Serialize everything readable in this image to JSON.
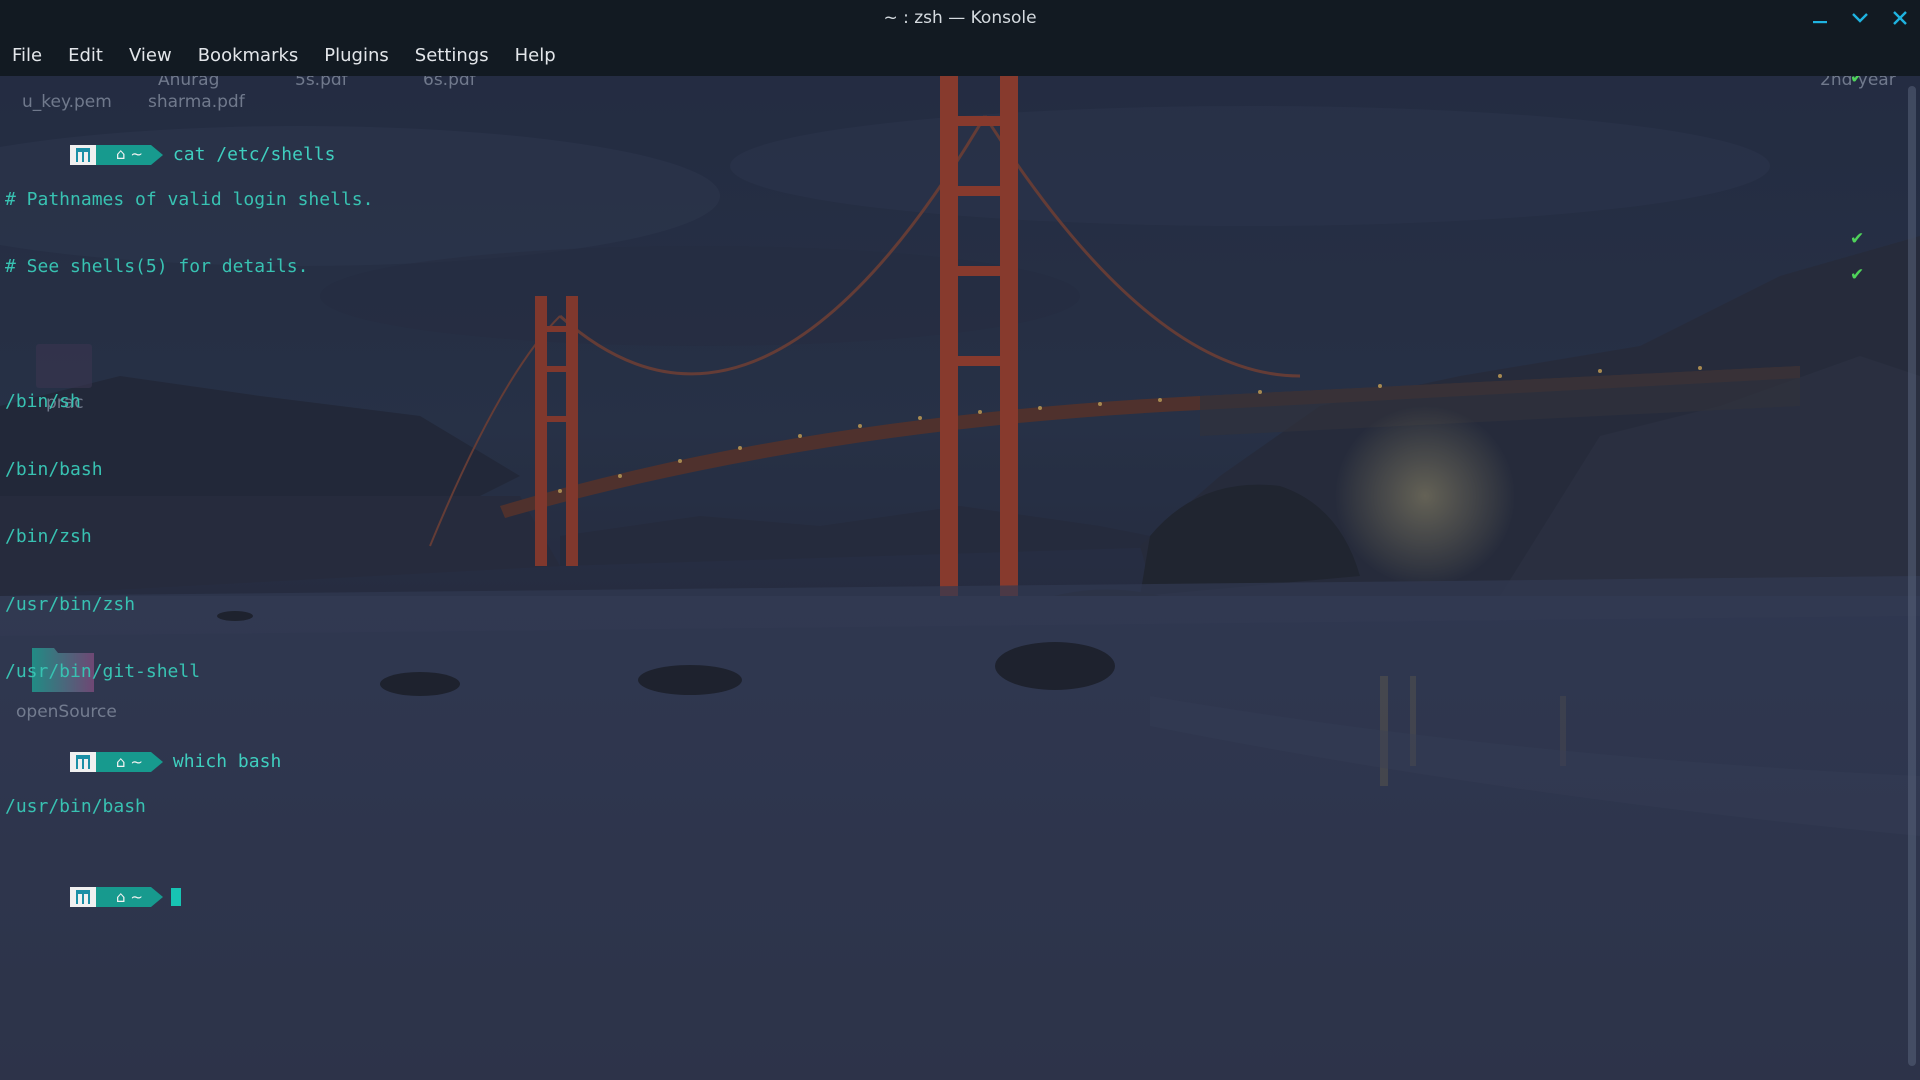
{
  "window": {
    "title": "~ : zsh — Konsole"
  },
  "menu": [
    "File",
    "Edit",
    "View",
    "Bookmarks",
    "Plugins",
    "Settings",
    "Help"
  ],
  "desktop": {
    "labels": [
      "u_key.pem",
      "Anurag",
      "sharma.pdf",
      "5s.pdf",
      "6s.pdf",
      "2nd year",
      "prac",
      "openSource"
    ],
    "folder_color": "#1f9a8e"
  },
  "prompt": {
    "dir": "~"
  },
  "terminal": {
    "cmd1": "cat /etc/shells",
    "out1": [
      "# Pathnames of valid login shells.",
      "# See shells(5) for details.",
      "",
      "/bin/sh",
      "/bin/bash",
      "/bin/zsh",
      "/usr/bin/zsh",
      "/usr/bin/git-shell"
    ],
    "cmd2": "which bash",
    "out2": [
      "/usr/bin/bash"
    ]
  },
  "status_marks": [
    "✔",
    "✔",
    "✔"
  ],
  "colors": {
    "accent": "#1fb3e0",
    "prompt_teal": "#179a8e",
    "text_teal": "#38c2b2",
    "check_green": "#4fd35a"
  }
}
